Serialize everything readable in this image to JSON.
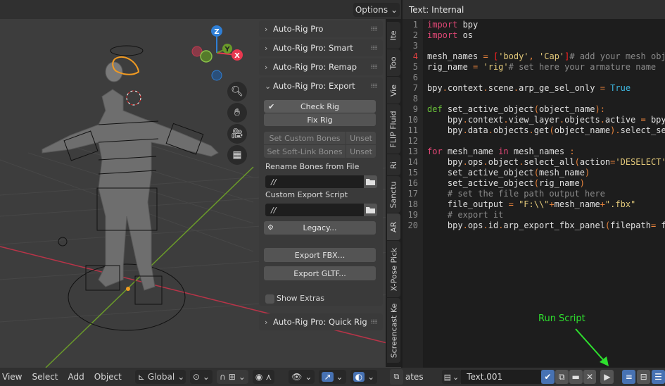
{
  "viewport": {
    "options_label": "Options",
    "axes": {
      "z": "Z",
      "y": "Y",
      "x": "X"
    },
    "colors": {
      "x_axis": "#e8384f",
      "y_axis": "#8bc34a",
      "z_axis": "#2f7fd6",
      "selection": "#f29b22",
      "x_line": "#b83448",
      "y_line": "#6a9a2a"
    },
    "nav_icons": [
      "zoom-icon",
      "pan-hand-icon",
      "camera-icon",
      "grid-view-icon"
    ]
  },
  "npanel": {
    "panels": [
      {
        "label": "Auto-Rig Pro",
        "expanded": false
      },
      {
        "label": "Auto-Rig Pro: Smart",
        "expanded": false
      },
      {
        "label": "Auto-Rig Pro: Remap",
        "expanded": false
      },
      {
        "label": "Auto-Rig Pro: Export",
        "expanded": true
      },
      {
        "label": "Auto-Rig Pro: Quick Rig",
        "expanded": false
      }
    ],
    "export": {
      "check_rig": "Check Rig",
      "fix_rig": "Fix Rig",
      "set_custom_bones": "Set Custom Bones",
      "set_soft_link_bones": "Set Soft-Link Bones",
      "unset": "Unset",
      "rename_bones_label": "Rename Bones from File",
      "rename_bones_value": "//",
      "custom_export_label": "Custom Export Script",
      "custom_export_value": "//",
      "legacy": "Legacy...",
      "export_fbx": "Export FBX...",
      "export_gltf": "Export GLTF...",
      "show_extras": "Show Extras",
      "show_extras_checked": false
    },
    "tabs": [
      "Ite",
      "Too",
      "Vie",
      "FLIP Fluid",
      "Ri",
      "Sanctu",
      "AR",
      "X-Pose Pick",
      "Screencast Ke"
    ],
    "active_tab": "AR"
  },
  "viewport_footer": {
    "menus": [
      "View",
      "Select",
      "Add",
      "Object"
    ],
    "orientation": "Global"
  },
  "text_editor": {
    "header": "Text: Internal",
    "current_line": 4,
    "lines": [
      {
        "n": "1",
        "code": "import bpy"
      },
      {
        "n": "2",
        "code": "import os"
      },
      {
        "n": "3",
        "code": ""
      },
      {
        "n": "4",
        "code": "mesh_names = ['body', 'Cap']# add your mesh objec"
      },
      {
        "n": "5",
        "code": "rig_name = 'rig'# set here your armature name"
      },
      {
        "n": "6",
        "code": ""
      },
      {
        "n": "7",
        "code": "bpy.context.scene.arp_ge_sel_only = True"
      },
      {
        "n": "8",
        "code": ""
      },
      {
        "n": "9",
        "code": "def set_active_object(object_name):"
      },
      {
        "n": "10",
        "code": "    bpy.context.view_layer.objects.active = bpy.d"
      },
      {
        "n": "11",
        "code": "    bpy.data.objects.get(object_name).select_set"
      },
      {
        "n": "12",
        "code": ""
      },
      {
        "n": "13",
        "code": "for mesh_name in mesh_names :"
      },
      {
        "n": "14",
        "code": "    bpy.ops.object.select_all(action='DESELECT')"
      },
      {
        "n": "15",
        "code": "    set_active_object(mesh_name)"
      },
      {
        "n": "16",
        "code": "    set_active_object(rig_name)"
      },
      {
        "n": "17",
        "code": "    # set the file path output here"
      },
      {
        "n": "18",
        "code": "    file_output = \"F:\\\\\"+mesh_name+\".fbx\""
      },
      {
        "n": "19",
        "code": "    # export it"
      },
      {
        "n": "20",
        "code": "    bpy.ops.id.arp_export_fbx_panel(filepath= fil"
      }
    ],
    "annotation": "Run Script",
    "annotation_color": "#2ee02e"
  },
  "text_footer": {
    "partial_menu": "ates",
    "text_name": "Text.001"
  }
}
